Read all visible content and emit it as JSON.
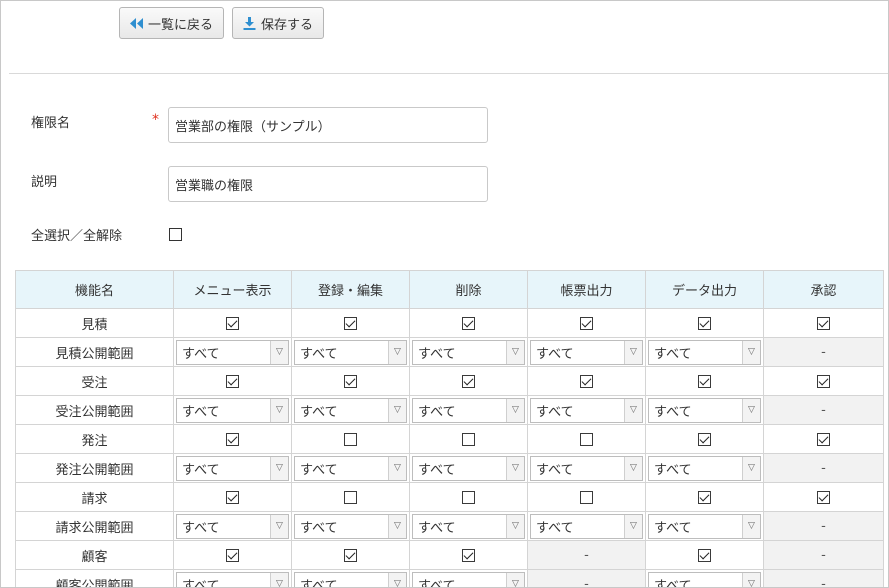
{
  "toolbar": {
    "back_label": "一覧に戻る",
    "save_label": "保存する"
  },
  "form": {
    "name_label": "権限名",
    "required_mark": "*",
    "name_value": "営業部の権限（サンプル）",
    "desc_label": "説明",
    "desc_value": "営業職の権限",
    "select_all_label": "全選択／全解除",
    "select_all_checked": false
  },
  "table": {
    "headers": [
      "機能名",
      "メニュー表示",
      "登録・編集",
      "削除",
      "帳票出力",
      "データ出力",
      "承認"
    ],
    "select_value": "すべて",
    "na_text": "-",
    "rows": [
      {
        "name": "見積",
        "type": "check",
        "cells": [
          true,
          true,
          true,
          true,
          true,
          true
        ]
      },
      {
        "name": "見積公開範囲",
        "type": "scope",
        "cells": [
          "sel",
          "sel",
          "sel",
          "sel",
          "sel",
          "-"
        ]
      },
      {
        "name": "受注",
        "type": "check",
        "cells": [
          true,
          true,
          true,
          true,
          true,
          true
        ]
      },
      {
        "name": "受注公開範囲",
        "type": "scope",
        "cells": [
          "sel",
          "sel",
          "sel",
          "sel",
          "sel",
          "-"
        ]
      },
      {
        "name": "発注",
        "type": "check",
        "cells": [
          true,
          false,
          false,
          false,
          true,
          true
        ]
      },
      {
        "name": "発注公開範囲",
        "type": "scope",
        "cells": [
          "sel",
          "sel",
          "sel",
          "sel",
          "sel",
          "-"
        ]
      },
      {
        "name": "請求",
        "type": "check",
        "cells": [
          true,
          false,
          false,
          false,
          true,
          true
        ]
      },
      {
        "name": "請求公開範囲",
        "type": "scope",
        "cells": [
          "sel",
          "sel",
          "sel",
          "sel",
          "sel",
          "-"
        ]
      },
      {
        "name": "顧客",
        "type": "check",
        "cells": [
          true,
          true,
          true,
          "-",
          true,
          "-"
        ]
      },
      {
        "name": "顧客公開範囲",
        "type": "scope",
        "cells": [
          "sel",
          "sel",
          "sel",
          "-",
          "sel",
          "-"
        ]
      }
    ]
  }
}
